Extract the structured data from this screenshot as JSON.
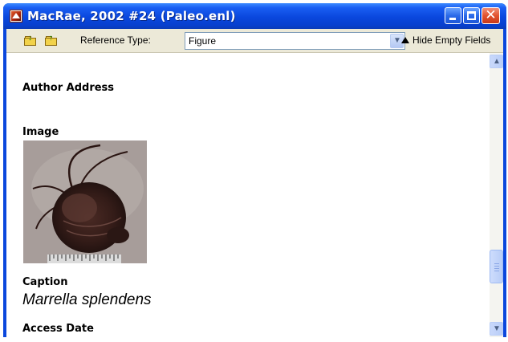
{
  "window": {
    "title": "MacRae, 2002 #24 (Paleo.enl)",
    "icon": "endnote-app-icon",
    "controls": [
      "minimize-icon",
      "maximize-icon",
      "close-icon"
    ],
    "close_glyph": "✕"
  },
  "toolbar": {
    "icons": [
      "previous-reference-icon",
      "next-reference-icon"
    ],
    "reference_type_label": "Reference Type:",
    "reference_type_value": "Figure",
    "dropdown_glyph": "▼",
    "hide_empty_label": "Hide Empty Fields"
  },
  "fields": {
    "author_address_label": "Author Address",
    "image_label": "Image",
    "caption_label": "Caption",
    "caption_value": "Marrella splendens",
    "access_date_label": "Access Date"
  },
  "scrollbar": {
    "up_glyph": "▲",
    "down_glyph": "▼",
    "position": 0.78
  },
  "colors": {
    "titlebar": "#0a47dd",
    "toolbar_bg": "#ece9d8",
    "close_button": "#e2532f"
  }
}
